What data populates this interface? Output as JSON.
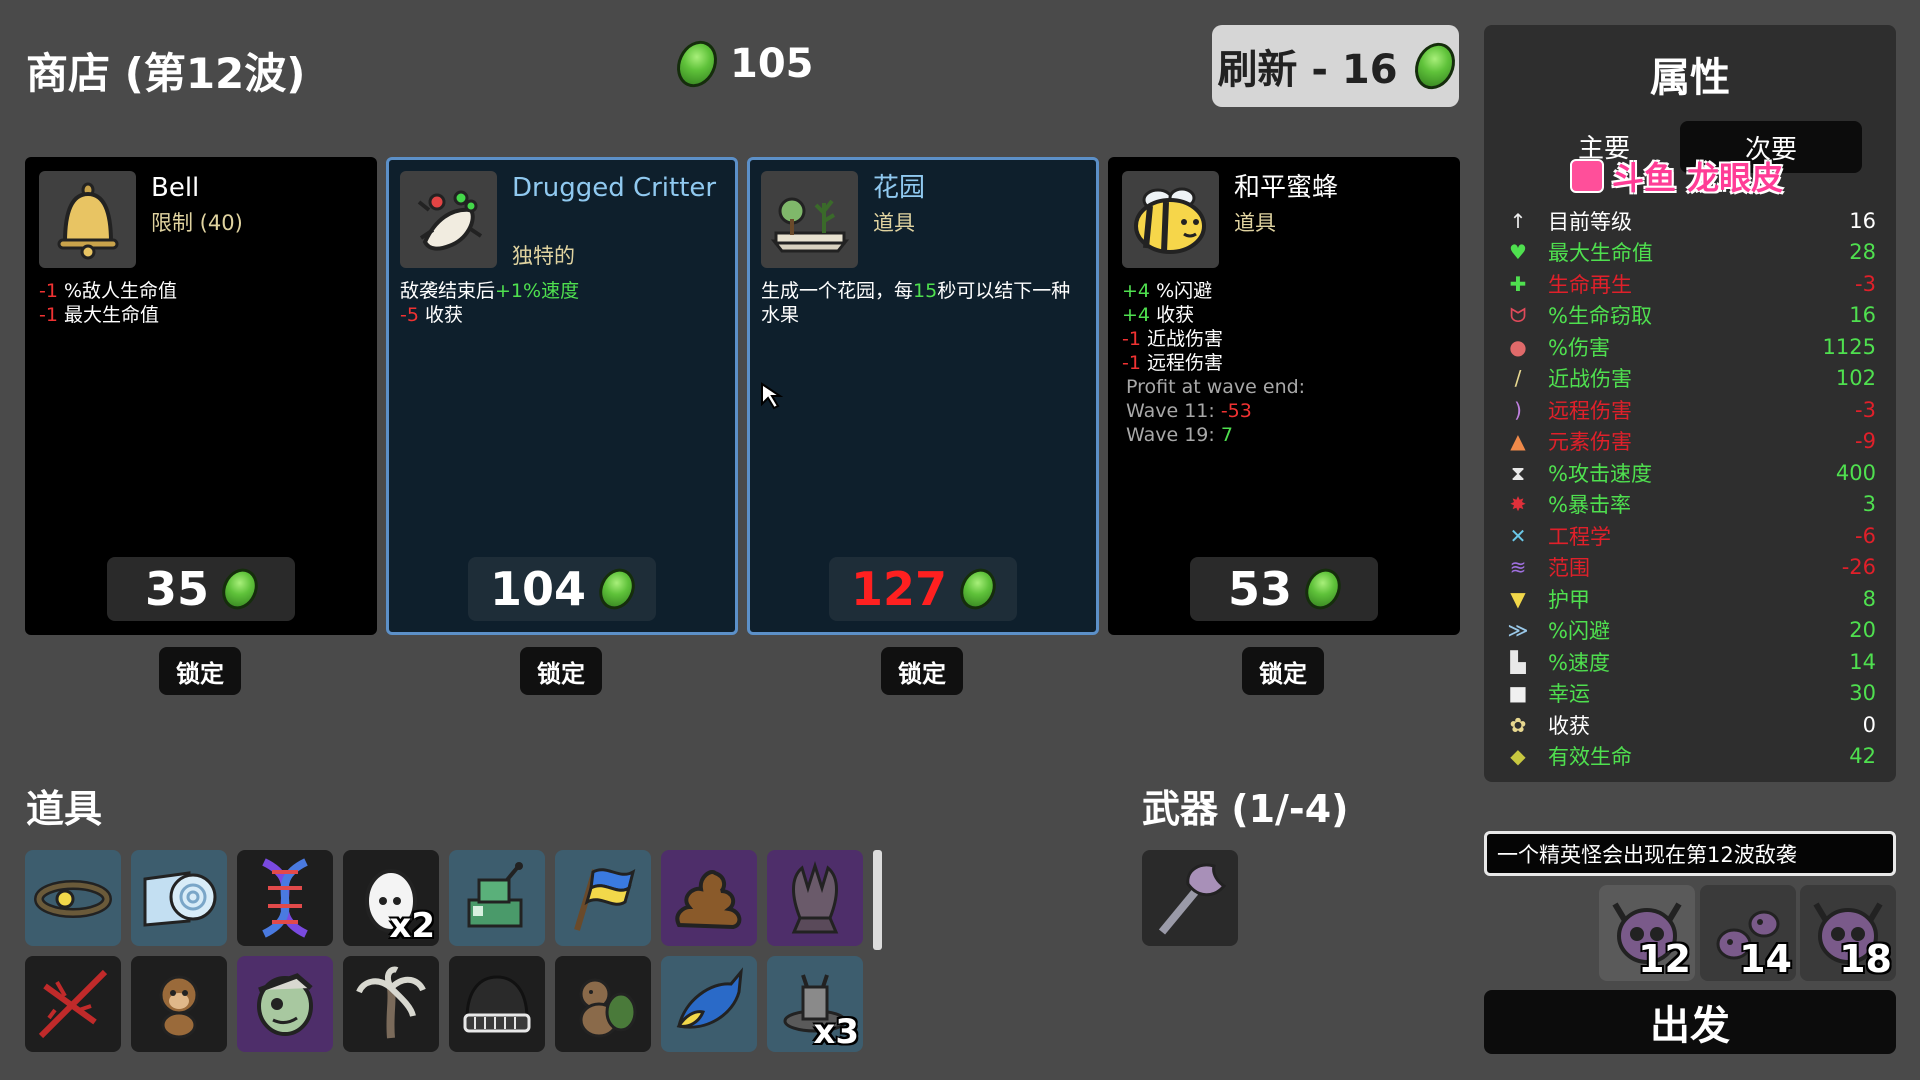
{
  "header": {
    "title": "商店 (第12波)",
    "gold": "105",
    "reroll_label": "刷新 - 16"
  },
  "cards": [
    {
      "name": "Bell",
      "kind": "限制 (40)",
      "lines": [
        [
          "-1",
          "%敌人生命值"
        ],
        [
          "-1",
          "最大生命值"
        ]
      ],
      "price": "35",
      "lock": "锁定"
    },
    {
      "name": "Drugged Critter",
      "kind": "独特的",
      "line1_pre": "敌袭结束后",
      "line1_val": "+1%速度",
      "line2_val": "-5",
      "line2_txt": " 收获",
      "price": "104",
      "lock": "锁定"
    },
    {
      "name": "花园",
      "kind": "道具",
      "desc_pre": "生成一个花园，每",
      "desc_val": "15",
      "desc_post": "秒可以结下一种水果",
      "price": "127",
      "lock": "锁定"
    },
    {
      "name": "和平蜜蜂",
      "kind": "道具",
      "lines": [
        [
          "+4",
          "%闪避"
        ],
        [
          "+4",
          "收获"
        ],
        [
          "-1",
          "近战伤害"
        ],
        [
          "-1",
          "远程伤害"
        ]
      ],
      "profit_title": "Profit at wave end:",
      "profit1_label": "Wave 11:",
      "profit1_val": "-53",
      "profit2_label": "Wave 19:",
      "profit2_val": "7",
      "price": "53",
      "lock": "锁定"
    }
  ],
  "items_section": {
    "title": "道具",
    "counts": {
      "egg": "x2",
      "turret": "x3"
    }
  },
  "weapons_section": {
    "title": "武器 (1/-4)"
  },
  "stats": {
    "title": "属性",
    "tab_primary": "主要",
    "tab_secondary": "次要",
    "watermark": "斗鱼 龙眼皮",
    "rows": [
      {
        "label": "目前等级",
        "value": "16",
        "tone": "neu",
        "icon": "level-icon"
      },
      {
        "label": "最大生命值",
        "value": "28",
        "tone": "pos",
        "icon": "heart-icon"
      },
      {
        "label": "生命再生",
        "value": "-3",
        "tone": "neg",
        "icon": "regen-icon"
      },
      {
        "label": "%生命窃取",
        "value": "16",
        "tone": "pos",
        "icon": "fang-icon"
      },
      {
        "label": "%伤害",
        "value": "1125",
        "tone": "pos",
        "icon": "muscle-icon"
      },
      {
        "label": "近战伤害",
        "value": "102",
        "tone": "pos",
        "icon": "sword-icon"
      },
      {
        "label": "远程伤害",
        "value": "-3",
        "tone": "neg",
        "icon": "bow-icon"
      },
      {
        "label": "元素伤害",
        "value": "-9",
        "tone": "neg",
        "icon": "flame-icon"
      },
      {
        "label": "%攻击速度",
        "value": "400",
        "tone": "pos",
        "icon": "hourglass-icon"
      },
      {
        "label": "%暴击率",
        "value": "3",
        "tone": "pos",
        "icon": "crit-icon"
      },
      {
        "label": "工程学",
        "value": "-6",
        "tone": "neg",
        "icon": "wrench-icon"
      },
      {
        "label": "范围",
        "value": "-26",
        "tone": "neg",
        "icon": "range-icon"
      },
      {
        "label": "护甲",
        "value": "8",
        "tone": "pos",
        "icon": "shield-icon"
      },
      {
        "label": "%闪避",
        "value": "20",
        "tone": "pos",
        "icon": "dodge-icon"
      },
      {
        "label": "%速度",
        "value": "14",
        "tone": "pos",
        "icon": "boot-icon"
      },
      {
        "label": "幸运",
        "value": "30",
        "tone": "pos",
        "icon": "dice-icon"
      },
      {
        "label": "收获",
        "value": "0",
        "tone": "neu",
        "icon": "harvest-icon"
      },
      {
        "label": "有效生命",
        "value": "42",
        "tone": "pos",
        "icon": "effective-hp-icon"
      }
    ]
  },
  "elite_message": "一个精英怪会出现在第12波敌袭",
  "waves": [
    "12",
    "14",
    "18"
  ],
  "go_label": "出发",
  "colors": {
    "background": "#4a4a4a",
    "positive": "#4fe04f",
    "negative": "#f03232",
    "special_border": "#5c90c8",
    "material": "#5fc23a"
  }
}
